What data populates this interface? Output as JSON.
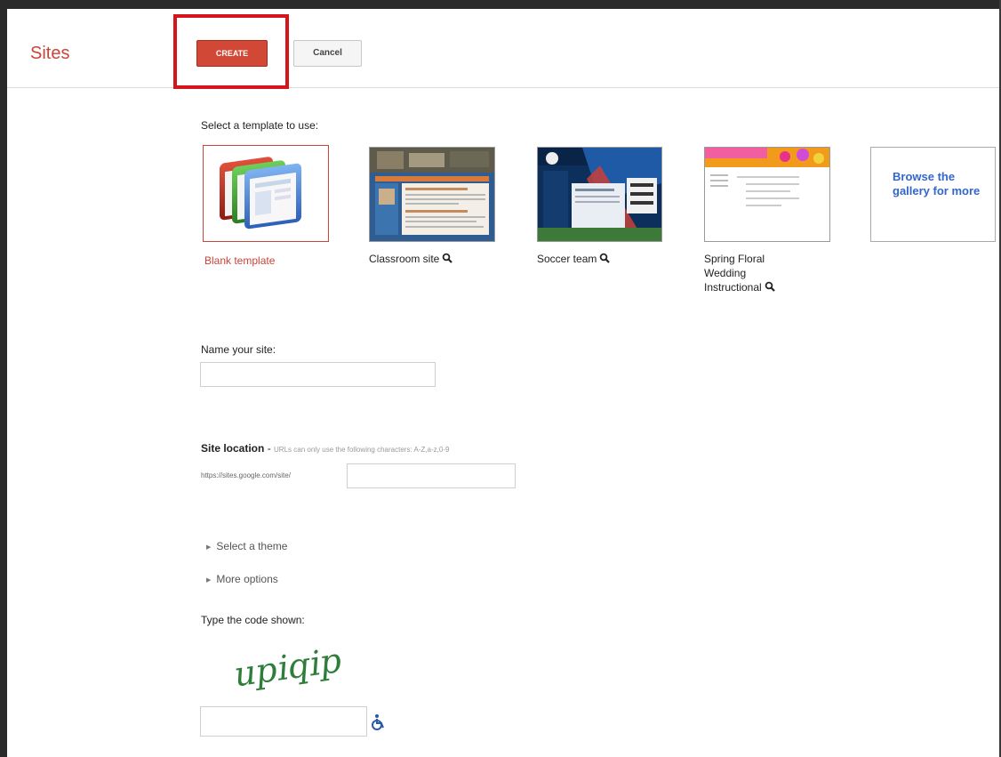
{
  "header": {
    "app_title": "Sites",
    "create_label": "CREATE",
    "cancel_label": "Cancel"
  },
  "templates": {
    "heading": "Select a template to use:",
    "items": [
      {
        "name": "Blank template",
        "selected": true
      },
      {
        "name": "Classroom site",
        "preview_icon": "magnifier-icon"
      },
      {
        "name": "Soccer team",
        "preview_icon": "magnifier-icon"
      },
      {
        "name_lines": [
          "Spring Floral",
          "Wedding",
          "Instructional"
        ],
        "preview_icon": "magnifier-icon"
      }
    ],
    "browse_text": "Browse the gallery for more"
  },
  "name_site": {
    "label": "Name your site:",
    "value": ""
  },
  "location": {
    "label": "Site location",
    "separator": "-",
    "hint": "URLs can only use the following characters: A-Z,a-z,0-9",
    "url_prefix": "https://sites.google.com/site/",
    "value": ""
  },
  "options": {
    "theme_label": "Select a theme",
    "more_label": "More options"
  },
  "captcha": {
    "label": "Type the code shown:",
    "image_text": "upiqip",
    "value": "",
    "accessibility_icon": "wheelchair-icon"
  },
  "colors": {
    "accent": "#d14836",
    "title": "#c9443a",
    "link": "#3366cc",
    "highlight": "#d6141c"
  }
}
